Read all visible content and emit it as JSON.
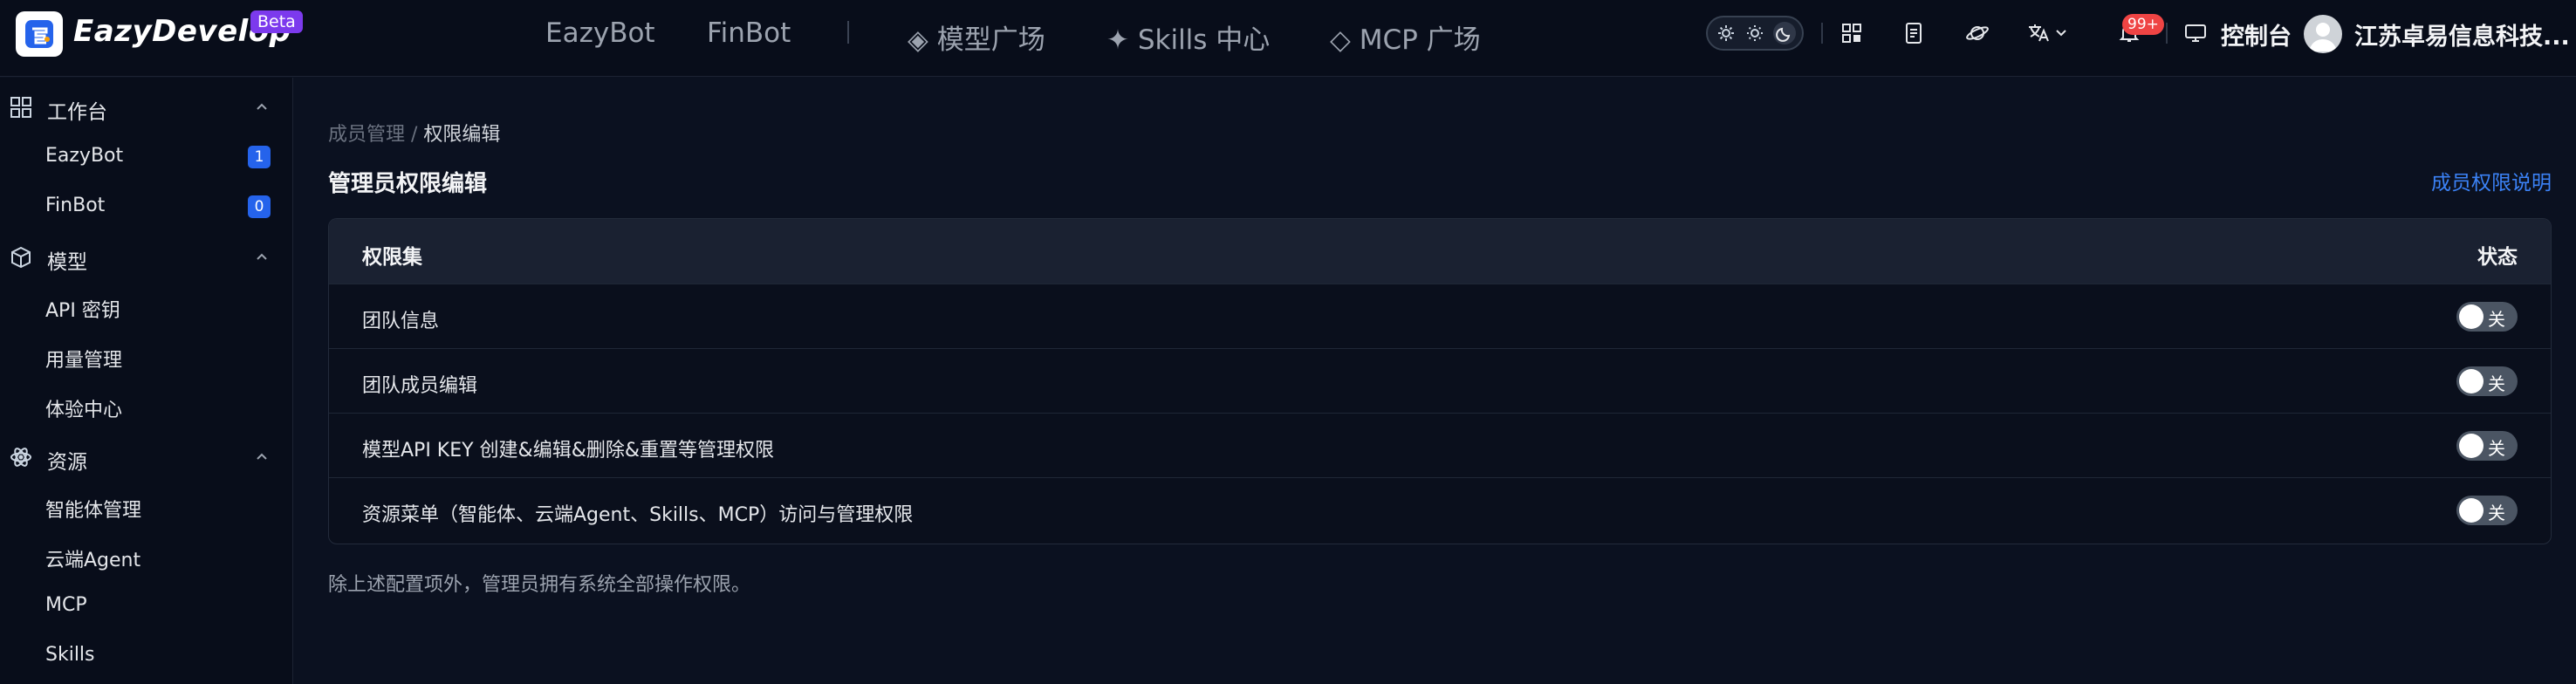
{
  "brand": {
    "name": "EazyDevelop",
    "badge": "Beta"
  },
  "topnav": {
    "items": [
      {
        "label": "EazyBot"
      },
      {
        "label": "FinBot"
      },
      {
        "label": "◈ 模型广场"
      },
      {
        "label": "✦ Skills 中心"
      },
      {
        "label": "◇ MCP 广场"
      }
    ]
  },
  "header": {
    "theme_modes": [
      "auto",
      "light",
      "dark"
    ],
    "notifications_badge": "99+",
    "console_label": "控制台",
    "org_name": "江苏卓易信息科技..."
  },
  "sidebar": {
    "groups": [
      {
        "label": "工作台",
        "icon": "grid-icon",
        "items": [
          {
            "label": "EazyBot",
            "count": "1"
          },
          {
            "label": "FinBot",
            "count": "0"
          }
        ]
      },
      {
        "label": "模型",
        "icon": "cube-icon",
        "items": [
          {
            "label": "API 密钥"
          },
          {
            "label": "用量管理"
          },
          {
            "label": "体验中心"
          }
        ]
      },
      {
        "label": "资源",
        "icon": "atom-icon",
        "items": [
          {
            "label": "智能体管理"
          },
          {
            "label": "云端Agent"
          },
          {
            "label": "MCP"
          },
          {
            "label": "Skills"
          }
        ]
      }
    ]
  },
  "main": {
    "breadcrumb": {
      "parent": "成员管理",
      "separator": " / ",
      "current": "权限编辑"
    },
    "title": "管理员权限编辑",
    "help_link": "成员权限说明",
    "table": {
      "col_name": "权限集",
      "col_status": "状态",
      "rows": [
        {
          "name": "团队信息",
          "status": "关",
          "enabled": false
        },
        {
          "name": "团队成员编辑",
          "status": "关",
          "enabled": false
        },
        {
          "name": "模型API KEY 创建&编辑&删除&重置等管理权限",
          "status": "关",
          "enabled": false
        },
        {
          "name": "资源菜单（智能体、云端Agent、Skills、MCP）访问与管理权限",
          "status": "关",
          "enabled": false
        }
      ]
    },
    "footnote": "除上述配置项外，管理员拥有系统全部操作权限。"
  },
  "colors": {
    "accent": "#3b82f6",
    "badge": "#7c3aed",
    "count_bg": "#2563eb",
    "alert": "#ef4444"
  }
}
